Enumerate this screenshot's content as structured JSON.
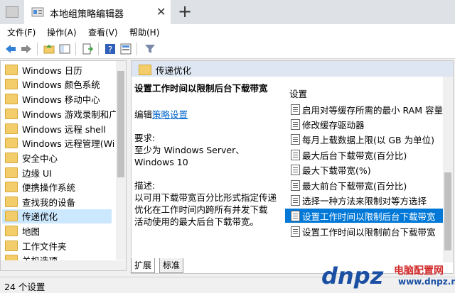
{
  "window": {
    "title": "本地组策略编辑器"
  },
  "menu": [
    "文件(F)",
    "操作(A)",
    "查看(V)",
    "帮助(H)"
  ],
  "tree": {
    "items": [
      "Windows 日历",
      "Windows 颜色系统",
      "Windows 移动中心",
      "Windows 游戏录制和广",
      "Windows 远程 shell",
      "Windows 远程管理(Wi",
      "安全中心",
      "边缘 UI",
      "便携操作系统",
      "查找我的设备",
      "传递优化",
      "地图",
      "工作文件夹",
      "关机选项"
    ],
    "selected_index": 10
  },
  "right": {
    "header": "传递优化",
    "desc": {
      "title": "设置工作时间以限制后台下载带宽",
      "edit_prefix": "编辑",
      "edit_link": "策略设置",
      "req_label": "要求:",
      "req_line1": "至少为 Windows Server、",
      "req_line2": "Windows 10",
      "desc_label": "描述:",
      "desc_line1": "以可用下载带宽百分比形式指定传递",
      "desc_line2": "优化在工作时间内跨所有并发下载",
      "desc_line3": "活动使用的最大后台下载带宽。"
    },
    "settings_header": "设置",
    "settings": [
      "启用对等缓存所需的最小 RAM 容量",
      "修改缓存驱动器",
      "每月上载数据上限(以 GB 为单位)",
      "最大后台下载带宽(百分比)",
      "最大下载带宽(%)",
      "最大前台下载带宽(百分比)",
      "选择一种方法来限制对等方选择",
      "设置工作时间以限制后台下载带宽",
      "设置工作时间以限制前台下载带宽"
    ],
    "selected_setting": 7
  },
  "bottom_tabs": [
    "扩展",
    "标准"
  ],
  "status": "24 个设置",
  "watermark": {
    "logo": "dnpz",
    "text1": "电脑配置网",
    "text2": "www.dnpz.net"
  }
}
